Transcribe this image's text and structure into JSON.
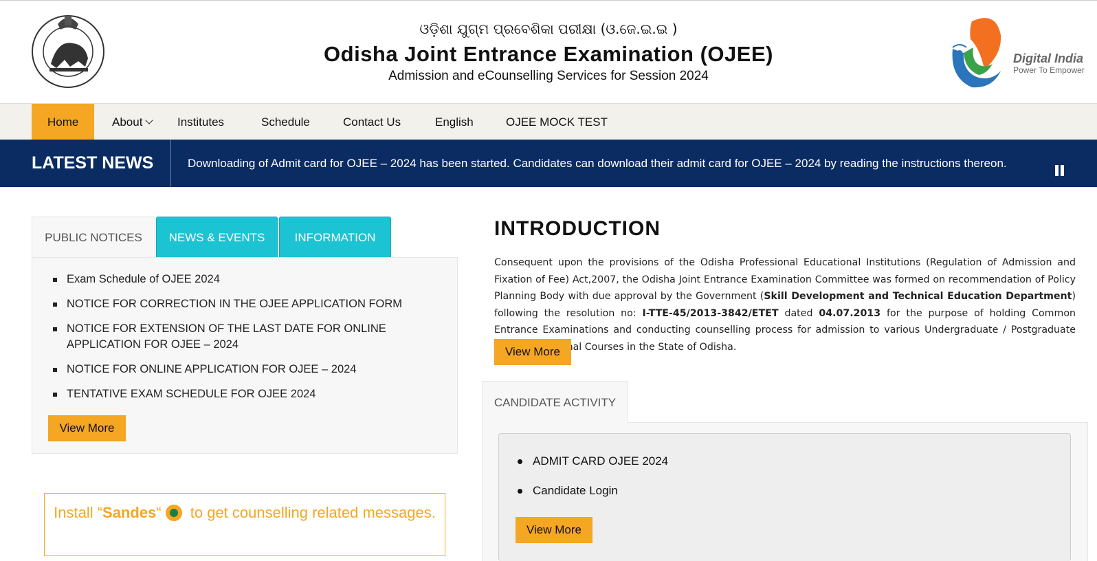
{
  "header": {
    "title_odia": "ଓଡ଼ିଶା ଯୁଗ୍ମ ପ୍ରବେଶିକା ପରୀକ୍ଷା (ଓ.ଜେ.ଇ.ଇ )",
    "title": "Odisha Joint Entrance Examination (OJEE)",
    "subtitle": "Admission and eCounselling Services for Session 2024",
    "digital_india": {
      "name": "Digital India",
      "tagline": "Power To Empower"
    }
  },
  "nav": {
    "items": [
      "Home",
      "About",
      "Institutes",
      "Schedule",
      "Contact Us",
      "English",
      "OJEE MOCK TEST"
    ]
  },
  "news": {
    "label": "LATEST NEWS",
    "ticker": "Downloading of Admit card for OJEE – 2024 has been started. Candidates can download their admit card for OJEE – 2024 by reading the instructions thereon."
  },
  "tabs": [
    "PUBLIC NOTICES",
    "NEWS & EVENTS",
    "INFORMATION"
  ],
  "notices": {
    "items": [
      "Exam Schedule of OJEE 2024",
      "NOTICE FOR CORRECTION IN THE OJEE APPLICATION FORM",
      "NOTICE FOR EXTENSION OF THE LAST DATE FOR ONLINE APPLICATION FOR OJEE – 2024",
      "NOTICE FOR ONLINE APPLICATION FOR OJEE – 2024",
      "TENTATIVE EXAM SCHEDULE FOR OJEE 2024"
    ],
    "view_more": "View More"
  },
  "sandes": {
    "prefix": "Install “",
    "name": "Sandes",
    "suffix": "“",
    "rest": " to get counselling related messages."
  },
  "intro": {
    "title": "INTRODUCTION",
    "p1": "Consequent upon the provisions of the Odisha Professional Educational Institutions (Regulation of Admission and Fixation of Fee) Act,2007, the Odisha Joint Entrance Examination Committee was formed on recommendation of Policy Planning Body with due approval by the Government (",
    "dept": "Skill Development and Technical Education Department",
    "p2": ") following the resolution no: ",
    "resolution": "I-TTE-45/2013-3842/ETET",
    "p3": " dated ",
    "date": "04.07.2013",
    "p4": " for the purpose of holding Common Entrance Examinations and conducting counselling process for admission to various Undergraduate / Postgraduate Level Professional Courses in the State of Odisha.",
    "view_more": "View More"
  },
  "candidate": {
    "tab": "CANDIDATE ACTIVITY",
    "items": [
      "ADMIT CARD OJEE 2024",
      "Candidate Login"
    ],
    "view_more": "View More"
  }
}
